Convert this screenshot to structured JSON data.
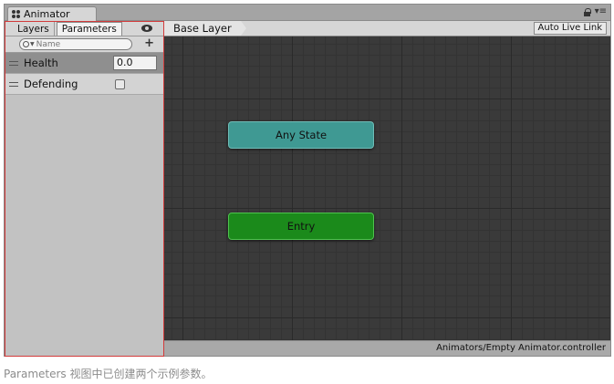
{
  "window": {
    "tab_title": "Animator",
    "menu_glyph": "▾≡"
  },
  "left_panel": {
    "tabs": [
      {
        "label": "Layers",
        "active": false
      },
      {
        "label": "Parameters",
        "active": true
      }
    ],
    "search_placeholder": "Name",
    "add_label": "+",
    "parameters": [
      {
        "name": "Health",
        "type": "float",
        "value": "0.0"
      },
      {
        "name": "Defending",
        "type": "bool",
        "value": false
      }
    ]
  },
  "graph": {
    "breadcrumb": "Base Layer",
    "auto_live_link": "Auto Live Link",
    "nodes": [
      {
        "label": "Any State",
        "color": "#3f9993"
      },
      {
        "label": "Entry",
        "color": "#1b8a1b"
      }
    ],
    "status_path": "Animators/Empty Animator.controller"
  },
  "caption": "Parameters 视图中已创建两个示例参数。",
  "colors": {
    "highlight_border": "#d23b3b",
    "graph_background": "#3a3a3a"
  }
}
